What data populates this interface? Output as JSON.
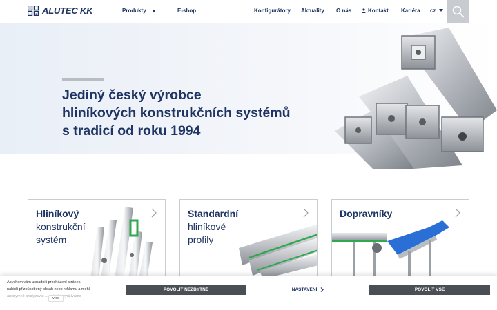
{
  "header": {
    "logo_text": "ALUTEC KK",
    "nav": {
      "produkty": "Produkty",
      "eshop": "E-shop",
      "konfiguratory": "Konfigurátory",
      "aktuality": "Aktuality",
      "o_nas": "O nás",
      "kontakt": "Kontakt",
      "kariera": "Kariéra",
      "language": "cz"
    }
  },
  "hero": {
    "title_lines": [
      "Jediný český výrobce",
      "hliníkových konstrukčních systémů",
      "s tradicí od roku 1994"
    ]
  },
  "cards": [
    {
      "lines": [
        "Hliníkový",
        "konstrukční",
        "systém"
      ]
    },
    {
      "lines": [
        "Standardní",
        "hliníkové",
        "profily"
      ]
    },
    {
      "lines": [
        "Dopravníky"
      ]
    }
  ],
  "cookie": {
    "text_lines": [
      "Abychom vám usnadnili procházení stránek,",
      "nabídli přizpůsobený obsah nebo reklamu a mohli",
      "anonymně analyzovat ... activitu, využíváme"
    ],
    "more_label": "více",
    "necessary_label": "POVOLIT NEZBYTNÉ",
    "settings_label": "NASTAVENÍ",
    "allow_all_label": "POVOLIT VŠE"
  },
  "colors": {
    "brand_navy": "#1e3463",
    "button_dark": "#4a4e55",
    "search_bg": "#c8cbd0",
    "conveyor_blue": "#2a6fd6",
    "accent_green": "#2fa84f"
  }
}
